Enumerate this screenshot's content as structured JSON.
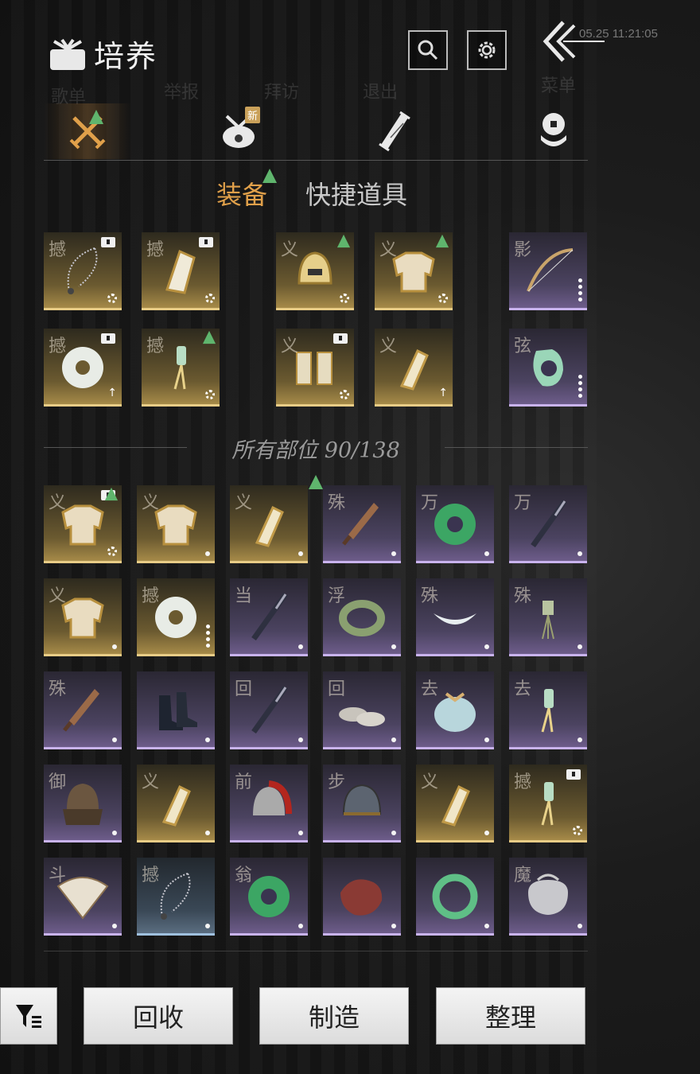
{
  "header": {
    "title": "培养",
    "timestamp": "05.25 11:21:05",
    "ghost_labels": [
      "歌单",
      "举报",
      "拜访",
      "退出",
      "菜单"
    ]
  },
  "category_tabs": [
    {
      "id": "weapons",
      "icon": "crossed-swords-icon",
      "active": true,
      "has_alert": true,
      "badge": ""
    },
    {
      "id": "bundle",
      "icon": "bundle-bag-icon",
      "active": false,
      "has_alert": false,
      "badge": "新"
    },
    {
      "id": "scroll",
      "icon": "scroll-icon",
      "active": false,
      "has_alert": false,
      "badge": ""
    },
    {
      "id": "coins",
      "icon": "coins-icon",
      "active": false,
      "has_alert": false,
      "badge": ""
    }
  ],
  "sub_tabs": {
    "equipment": "装备",
    "quick_items": "快捷道具"
  },
  "equipped_slots": [
    {
      "mark": "撼",
      "tier": "gold",
      "item": "pendant-chain",
      "tag": true,
      "alert": false,
      "corner": "gear"
    },
    {
      "mark": "撼",
      "tier": "gold",
      "item": "gauntlet",
      "tag": true,
      "alert": false,
      "corner": "gear"
    },
    {
      "mark": "义",
      "tier": "gold",
      "item": "helmet",
      "tag": false,
      "alert": true,
      "corner": "gear"
    },
    {
      "mark": "义",
      "tier": "gold",
      "item": "armor",
      "tag": false,
      "alert": true,
      "corner": "gear"
    },
    {
      "mark": "影",
      "tier": "purple",
      "item": "bow",
      "tag": false,
      "alert": false,
      "corner": "dots"
    },
    {
      "mark": "撼",
      "tier": "gold",
      "item": "jade-disc",
      "tag": true,
      "alert": false,
      "corner": "arrow"
    },
    {
      "mark": "撼",
      "tier": "gold",
      "item": "tassel",
      "tag": false,
      "alert": true,
      "corner": "gear"
    },
    {
      "mark": "义",
      "tier": "gold",
      "item": "bracers",
      "tag": true,
      "alert": false,
      "corner": "gear"
    },
    {
      "mark": "义",
      "tier": "gold",
      "item": "bracer",
      "tag": false,
      "alert": false,
      "corner": "arrow"
    },
    {
      "mark": "弦",
      "tier": "purple",
      "item": "jade-ring",
      "tag": false,
      "alert": false,
      "corner": "dots"
    }
  ],
  "inventory_header": {
    "label": "所有部位 90/138"
  },
  "inventory": [
    {
      "mark": "义",
      "tier": "gold",
      "item": "armor",
      "tag": true,
      "alert": true,
      "corner": "gear"
    },
    {
      "mark": "义",
      "tier": "gold",
      "item": "armor",
      "tag": false,
      "alert": false,
      "corner": "dot"
    },
    {
      "mark": "义",
      "tier": "gold",
      "item": "bracer",
      "tag": false,
      "alert": false,
      "corner": "dot"
    },
    {
      "mark": "殊",
      "tier": "purple",
      "item": "dagger",
      "tag": false,
      "alert": false,
      "corner": "dot"
    },
    {
      "mark": "万",
      "tier": "purple",
      "item": "jade-disc-green",
      "tag": false,
      "alert": false,
      "corner": "dot"
    },
    {
      "mark": "万",
      "tier": "purple",
      "item": "sword",
      "tag": false,
      "alert": false,
      "corner": "dot"
    },
    {
      "mark": "义",
      "tier": "gold",
      "item": "armor",
      "tag": false,
      "alert": false,
      "corner": "dot"
    },
    {
      "mark": "撼",
      "tier": "gold",
      "item": "jade-disc",
      "tag": false,
      "alert": false,
      "corner": "dots"
    },
    {
      "mark": "当",
      "tier": "purple",
      "item": "sword",
      "tag": false,
      "alert": false,
      "corner": "dot"
    },
    {
      "mark": "浮",
      "tier": "purple",
      "item": "ring",
      "tag": false,
      "alert": false,
      "corner": "dot"
    },
    {
      "mark": "殊",
      "tier": "purple",
      "item": "crescent",
      "tag": false,
      "alert": false,
      "corner": "dot"
    },
    {
      "mark": "殊",
      "tier": "purple",
      "item": "bell",
      "tag": false,
      "alert": false,
      "corner": "dot"
    },
    {
      "mark": "殊",
      "tier": "purple",
      "item": "dagger",
      "tag": false,
      "alert": false,
      "corner": "dot"
    },
    {
      "mark": "",
      "tier": "purple",
      "item": "boots",
      "tag": false,
      "alert": false,
      "corner": "dot"
    },
    {
      "mark": "回",
      "tier": "purple",
      "item": "sword",
      "tag": false,
      "alert": false,
      "corner": "dot"
    },
    {
      "mark": "回",
      "tier": "purple",
      "item": "shoes",
      "tag": false,
      "alert": false,
      "corner": "dot"
    },
    {
      "mark": "去",
      "tier": "purple",
      "item": "pouch",
      "tag": false,
      "alert": false,
      "corner": "dot"
    },
    {
      "mark": "去",
      "tier": "purple",
      "item": "tassel",
      "tag": false,
      "alert": false,
      "corner": "dot"
    },
    {
      "mark": "御",
      "tier": "purple",
      "item": "helmet-dark",
      "tag": false,
      "alert": false,
      "corner": "dot"
    },
    {
      "mark": "义",
      "tier": "gold",
      "item": "bracer",
      "tag": false,
      "alert": false,
      "corner": "dot"
    },
    {
      "mark": "前",
      "tier": "purple",
      "item": "helmet-red",
      "tag": false,
      "alert": false,
      "corner": "dot"
    },
    {
      "mark": "步",
      "tier": "purple",
      "item": "helmet-iron",
      "tag": false,
      "alert": false,
      "corner": "dot"
    },
    {
      "mark": "义",
      "tier": "gold",
      "item": "bracer",
      "tag": false,
      "alert": false,
      "corner": "dot"
    },
    {
      "mark": "撼",
      "tier": "gold",
      "item": "tassel",
      "tag": true,
      "alert": false,
      "corner": "gear"
    },
    {
      "mark": "斗",
      "tier": "purple",
      "item": "fan",
      "tag": false,
      "alert": false,
      "corner": "dot"
    },
    {
      "mark": "撼",
      "tier": "blue",
      "item": "pendant-chain",
      "tag": false,
      "alert": false,
      "corner": "dot"
    },
    {
      "mark": "翁",
      "tier": "purple",
      "item": "jade-disc-green",
      "tag": false,
      "alert": false,
      "corner": "dot"
    },
    {
      "mark": "",
      "tier": "purple",
      "item": "cloth",
      "tag": false,
      "alert": false,
      "corner": "dot"
    },
    {
      "mark": "",
      "tier": "purple",
      "item": "jade-ring-green",
      "tag": false,
      "alert": false,
      "corner": "dot"
    },
    {
      "mark": "魔",
      "tier": "purple",
      "item": "silver-lock",
      "tag": false,
      "alert": false,
      "corner": "dot"
    }
  ],
  "actions": {
    "recycle": "回收",
    "craft": "制造",
    "organize": "整理"
  },
  "colors": {
    "accent_gold": "#e0a04a",
    "alert_green": "#5fb56d",
    "tier_gold": "#a68a48",
    "tier_purple": "#6d5c8a",
    "tier_blue": "#5a6d80"
  }
}
